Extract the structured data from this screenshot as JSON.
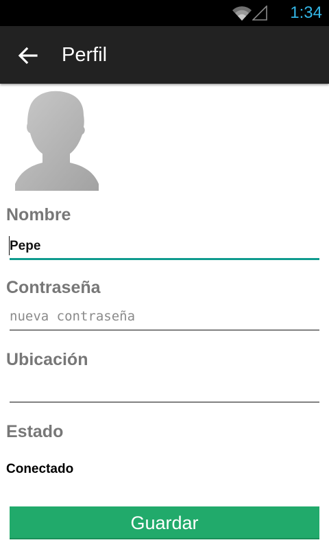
{
  "status_bar": {
    "time": "1:34",
    "wifi_icon": "wifi-icon",
    "signal_icon": "signal-icon",
    "clock_color": "#33b5e5"
  },
  "action_bar": {
    "title": "Perfil",
    "back_icon": "arrow-back-icon"
  },
  "profile": {
    "avatar_icon": "default-avatar-silhouette",
    "fields": {
      "name": {
        "label": "Nombre",
        "value": "Pepe"
      },
      "password": {
        "label": "Contraseña",
        "placeholder": "nueva contraseña"
      },
      "location": {
        "label": "Ubicación",
        "value": ""
      },
      "status": {
        "label": "Estado",
        "value": "Conectado"
      }
    },
    "save_button": "Guardar"
  },
  "colors": {
    "accent": "#0f9b8e",
    "button": "#21aa6b",
    "action_bar": "#222222"
  }
}
